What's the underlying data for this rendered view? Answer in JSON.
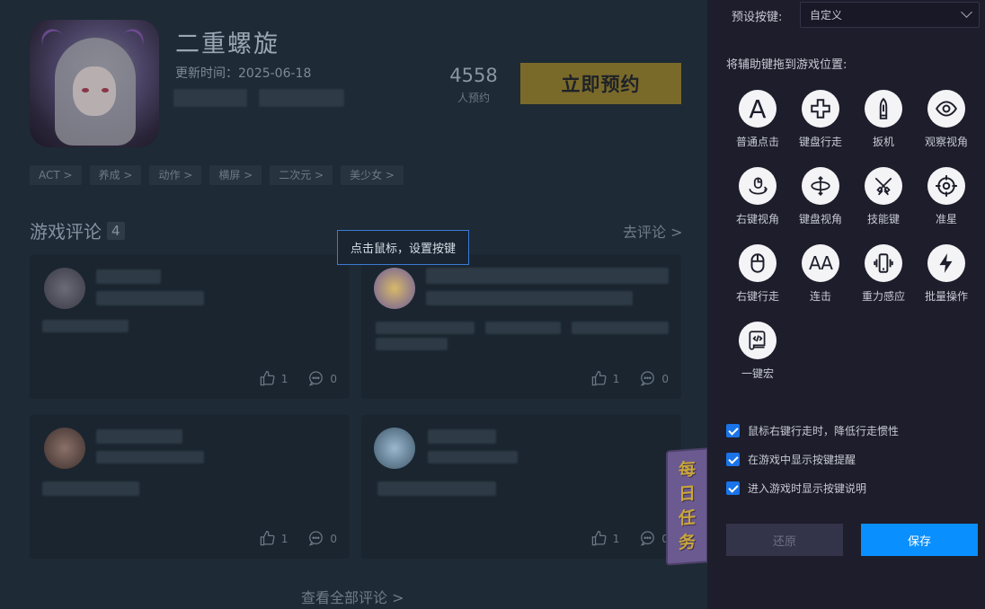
{
  "game": {
    "title": "二重螺旋",
    "update_time": "更新时间：2025-06-18",
    "reserve_count": "4558",
    "reserve_count_label": "人预约",
    "reserve_button": "立即预约",
    "tags": [
      "ACT >",
      "养成 >",
      "动作 >",
      "横屏 >",
      "二次元 >",
      "美少女 >"
    ]
  },
  "comments": {
    "title": "游戏评论",
    "count": "4",
    "go_comment": "去评论 >",
    "view_all": "查看全部评论 >",
    "cards": [
      {
        "likes": "1",
        "replies": "0",
        "avatar_color": "#4a4a55"
      },
      {
        "likes": "1",
        "replies": "0",
        "avatar_color": "#c8a050"
      },
      {
        "likes": "1",
        "replies": "0",
        "avatar_color": "#5a4844"
      },
      {
        "likes": "1",
        "replies": "0",
        "avatar_color": "#6a8aa8"
      }
    ]
  },
  "daily_task": [
    "每",
    "日",
    "任",
    "务"
  ],
  "tooltip": "点击鼠标，设置按键",
  "panel": {
    "preset_label": "预设按键:",
    "preset_value": "自定义",
    "drag_hint": "将辅助键拖到游戏位置:",
    "keys": [
      {
        "label": "普通点击",
        "icon": "letter-a-icon"
      },
      {
        "label": "键盘行走",
        "icon": "dpad-icon"
      },
      {
        "label": "扳机",
        "icon": "bullet-icon"
      },
      {
        "label": "观察视角",
        "icon": "eye-icon"
      },
      {
        "label": "右键视角",
        "icon": "mouse-rotate-icon"
      },
      {
        "label": "键盘视角",
        "icon": "rotate-icon"
      },
      {
        "label": "技能键",
        "icon": "swords-icon"
      },
      {
        "label": "准星",
        "icon": "crosshair-icon"
      },
      {
        "label": "右键行走",
        "icon": "mouse-icon"
      },
      {
        "label": "连击",
        "icon": "double-a-icon"
      },
      {
        "label": "重力感应",
        "icon": "phone-vibrate-icon"
      },
      {
        "label": "批量操作",
        "icon": "lightning-icon"
      },
      {
        "label": "一键宏",
        "icon": "script-icon"
      }
    ],
    "options": [
      "鼠标右键行走时，降低行走惯性",
      "在游戏中显示按键提醒",
      "进入游戏时显示按键说明"
    ],
    "restore_button": "还原",
    "save_button": "保存"
  },
  "colors": {
    "accent": "#0a8fff",
    "checkbox": "#1a73e8",
    "panel_bg": "#1d1d2b",
    "reserve_btn": "#7a6a2a"
  }
}
